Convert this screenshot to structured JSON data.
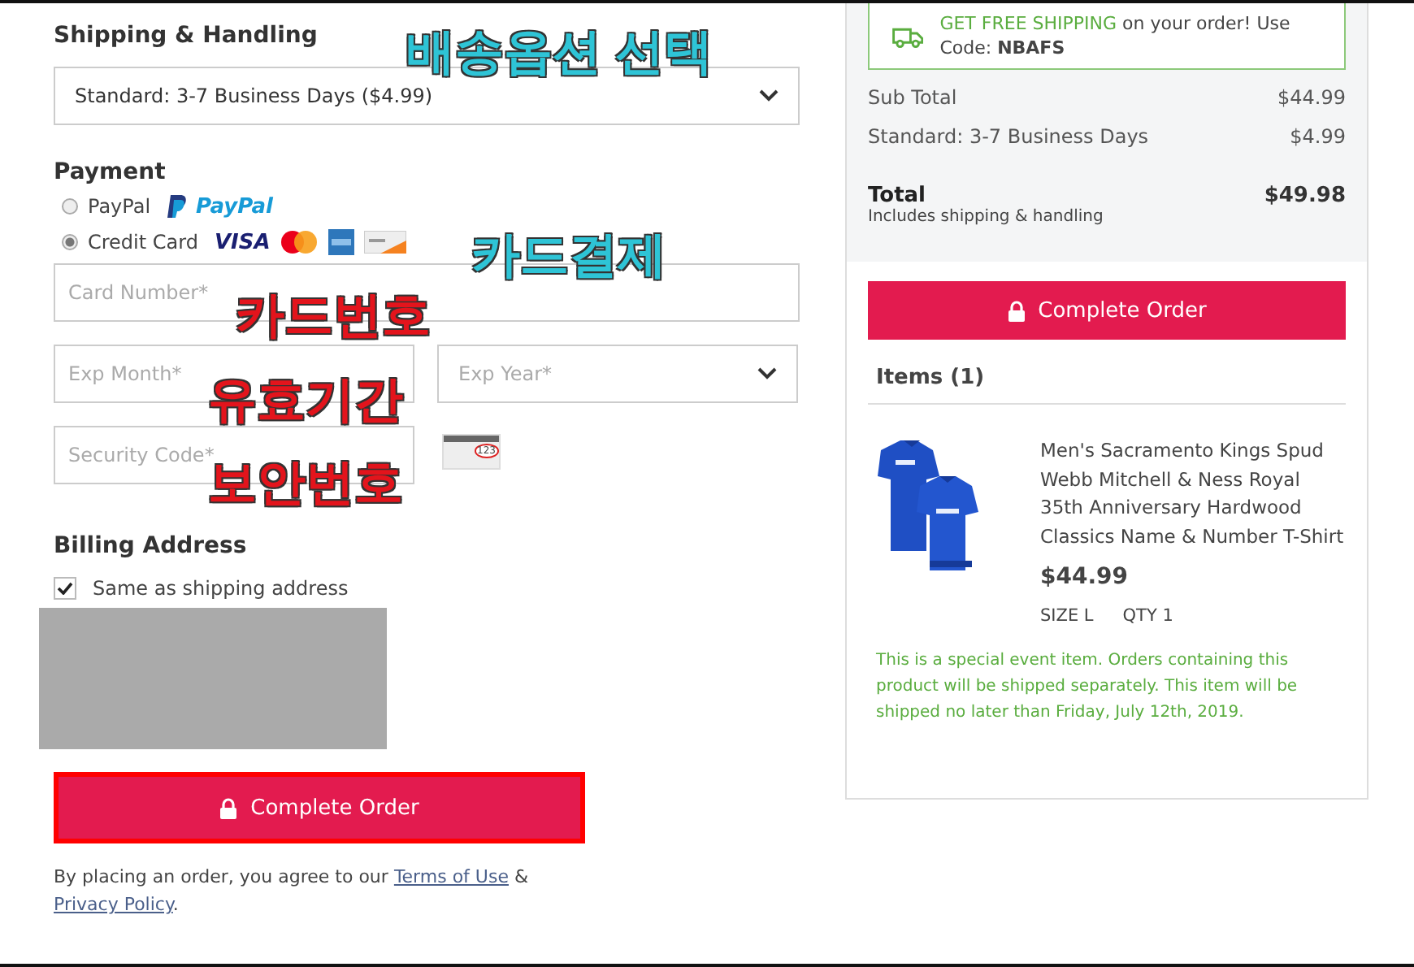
{
  "shipping": {
    "heading": "Shipping & Handling",
    "select_value": "Standard: 3-7 Business Days ($4.99)"
  },
  "payment": {
    "heading": "Payment",
    "methods": [
      {
        "kind": "paypal",
        "label": "PayPal",
        "selected": false,
        "logo_text": "PayPal"
      },
      {
        "kind": "card",
        "label": "Credit Card",
        "selected": true,
        "logo_text": "VISA"
      }
    ],
    "card_number": {
      "placeholder": "Card Number*"
    },
    "exp_month": {
      "placeholder": "Exp Month*"
    },
    "exp_year": {
      "placeholder": "Exp Year*"
    },
    "security_code": {
      "placeholder": "Security Code*"
    },
    "cvv_hint": "123"
  },
  "billing": {
    "heading": "Billing Address",
    "same_as_shipping": {
      "label": "Same as shipping address",
      "checked": true
    }
  },
  "complete_button": {
    "label": "Complete Order",
    "highlighted": true
  },
  "terms": {
    "text": "By placing an order, you agree to our",
    "terms_link": "Terms of Use",
    "joiner": "&",
    "privacy_link": "Privacy Policy",
    "end": "."
  },
  "summary": {
    "promo": {
      "highlight": "GET FREE SHIPPING",
      "text": "on your order! Use",
      "code_label": "Code:",
      "code": "NBAFS"
    },
    "lines": [
      {
        "label": "Sub Total",
        "amount": "$44.99"
      },
      {
        "label": "Standard: 3-7 Business Days",
        "amount": "$4.99"
      }
    ],
    "total": {
      "label": "Total",
      "note": "Includes shipping & handling",
      "amount": "$49.98"
    },
    "button": {
      "label": "Complete Order"
    },
    "items_heading": "Items (1)",
    "items": [
      {
        "name": "Men's Sacramento Kings Spud Webb Mitchell & Ness Royal 35th Anniversary Hardwood Classics Name & Number T-Shirt",
        "price": "$44.99",
        "size": "SIZE L",
        "qty": "QTY 1",
        "note": "This is a special event item. Orders containing this product will be shipped separately. This item will be shipped no later than Friday, July 12th, 2019."
      }
    ]
  },
  "annotations": [
    {
      "text": "배송옵션 선택",
      "color": "#2ec4d6"
    },
    {
      "text": "카드결제",
      "color": "#2ec4d6"
    },
    {
      "text": "카드번호",
      "color": "#e3141c"
    },
    {
      "text": "유효기간",
      "color": "#e3141c"
    },
    {
      "text": "보안번호",
      "color": "#e3141c"
    }
  ]
}
